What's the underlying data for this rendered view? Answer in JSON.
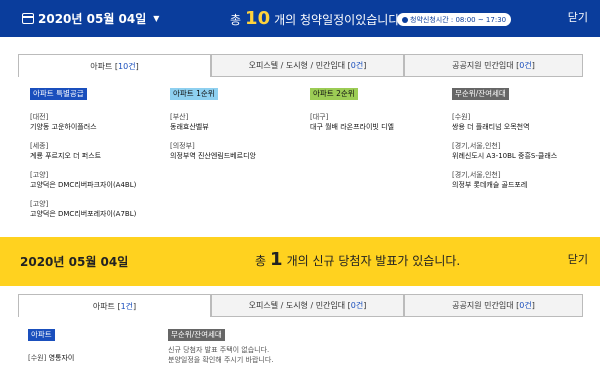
{
  "top": {
    "date": "2020년 05월 04일",
    "summary_pre": "총",
    "summary_num": "10",
    "summary_post": "개의 청약일정이있습니다.",
    "time_pill": "청약신청시간 : 08:00 ~ 17:30",
    "close": "닫기",
    "tabs": [
      {
        "label": "아파트 [",
        "count": "10건",
        "suffix": "]"
      },
      {
        "label": "오피스텔 / 도시형 / 민간임대 [",
        "count": "0건",
        "suffix": "]"
      },
      {
        "label": "공공지원 민간임대 [",
        "count": "0건",
        "suffix": "]"
      }
    ],
    "columns": [
      {
        "tag": "아파트 특별공급",
        "groups": [
          {
            "region": "[대전]",
            "name": "기양동 고운하이플러스"
          },
          {
            "region": "[세종]",
            "name": "계룡 푸르지오 더 퍼스트"
          },
          {
            "region": "[고양]",
            "name": "고양덕은 DMC리버파크자이(A4BL)"
          },
          {
            "region": "[고양]",
            "name": "고양덕은 DMC리버포레자이(A7BL)"
          }
        ]
      },
      {
        "tag": "아파트 1순위",
        "groups": [
          {
            "region": "[부산]",
            "name": "동래효산벨뷰"
          },
          {
            "region": "[의정부]",
            "name": "의정부역 진산엔림드베르디앙"
          }
        ]
      },
      {
        "tag": "아파트 2순위",
        "groups": [
          {
            "region": "[대구]",
            "name": "대구 월배 라온프라이빗 디엘"
          }
        ]
      },
      {
        "tag": "무순위/잔여세대",
        "groups": [
          {
            "region": "[수원]",
            "name": "쌍용 더 플래티넘 오목천역"
          },
          {
            "region": "[경기,서울,인천]",
            "name": "위례신도시 A3-10BL 중흥S-클래스"
          },
          {
            "region": "[경기,서울,인천]",
            "name": "의정부 롯데캐슬 골드포레"
          }
        ]
      }
    ]
  },
  "bottom": {
    "date": "2020년 05월 04일",
    "summary_pre": "총",
    "summary_num": "1",
    "summary_post": "개의 신규 당첨자 발표가 있습니다.",
    "close": "닫기",
    "tabs": [
      {
        "label": "아파트 [",
        "count": "1건",
        "suffix": "]"
      },
      {
        "label": "오피스텔 / 도시형 / 민간임대 [",
        "count": "0건",
        "suffix": "]"
      },
      {
        "label": "공공지원 민간임대 [",
        "count": "0건",
        "suffix": "]"
      }
    ],
    "col1": {
      "tag": "아파트",
      "region": "[수원]",
      "name": "영통자이"
    },
    "col2": {
      "tag": "무순위/잔여세대",
      "note1": "신규 당첨자 발표 주택이 없습니다.",
      "note2": "분양일정을 확인해 주시기 바랍니다."
    }
  },
  "colors": {
    "top_bar": "#0a3d9c",
    "bottom_bar": "#ffd21f",
    "accent_count": "#1a4fbd"
  }
}
